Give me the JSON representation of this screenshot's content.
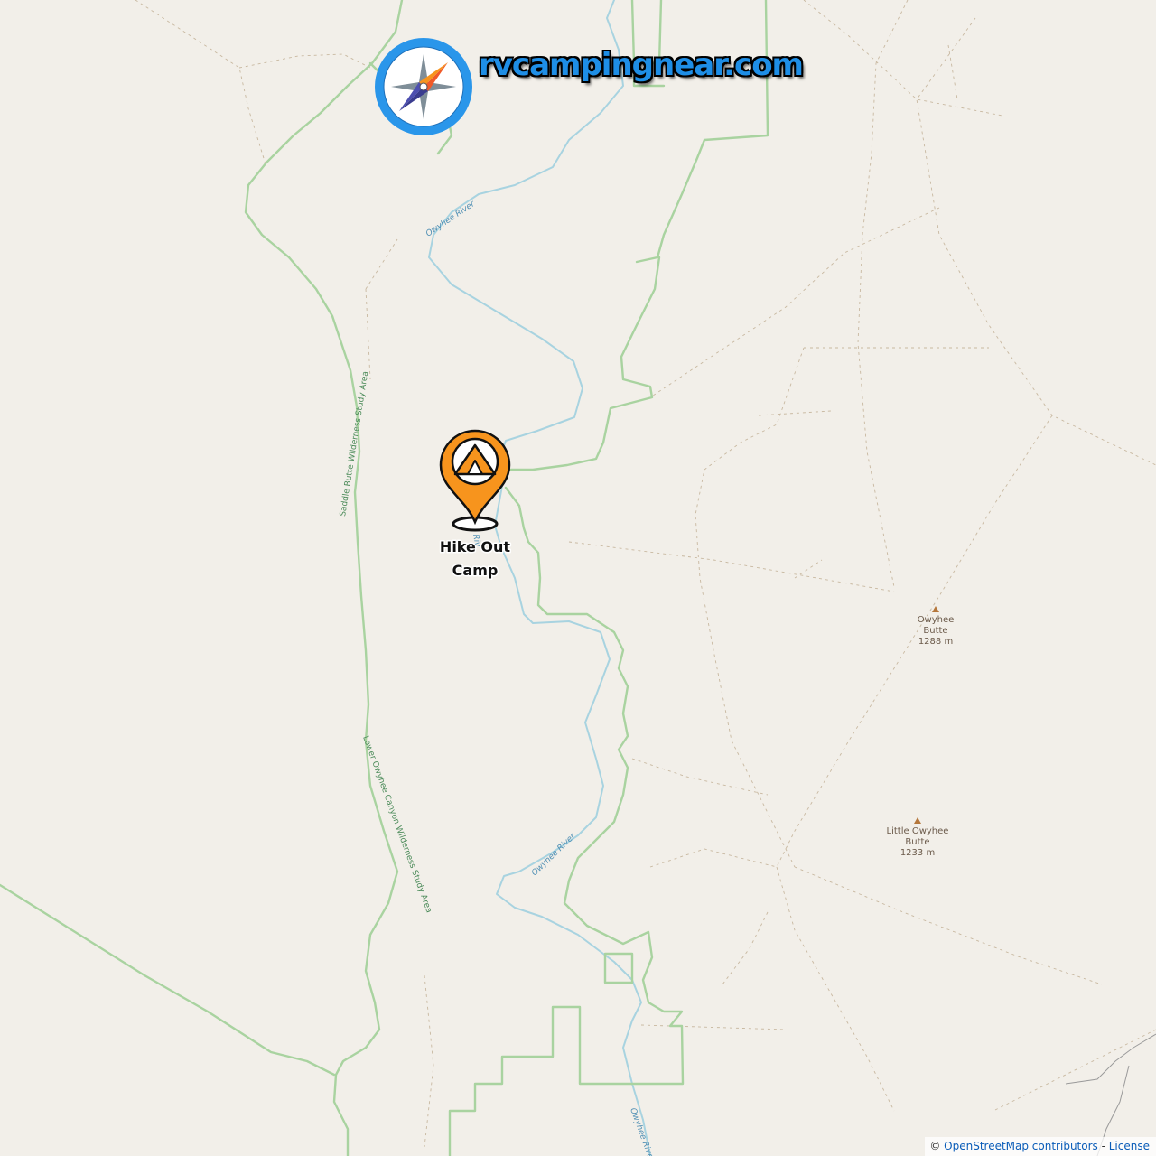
{
  "branding": {
    "logo_text": "rvcampingnear.com",
    "logo_icon": "compass-icon",
    "accent": "#1e8ee6"
  },
  "campsite": {
    "name_line1": "Hike Out",
    "name_line2": "Camp",
    "icon": "tent-icon",
    "marker_color": "#f7941d"
  },
  "labels": {
    "wsa_saddle": "Saddle Butte Wilderness Study Area",
    "wsa_lower": "Lower Owyhee Canyon Wilderness Study Area",
    "river_1": "Owyhee River",
    "river_2": "Owyhee River",
    "river_3": "Owyhee River",
    "river_near_camp": "Riv"
  },
  "peaks": [
    {
      "name_line1": "Owyhee",
      "name_line2": "Butte",
      "elevation": "1288 m"
    },
    {
      "name_line1": "Little Owyhee",
      "name_line2": "Butte",
      "elevation": "1233 m"
    }
  ],
  "attribution": {
    "symbol": "©",
    "source": "OpenStreetMap contributors",
    "separator": " - ",
    "license": "License"
  }
}
